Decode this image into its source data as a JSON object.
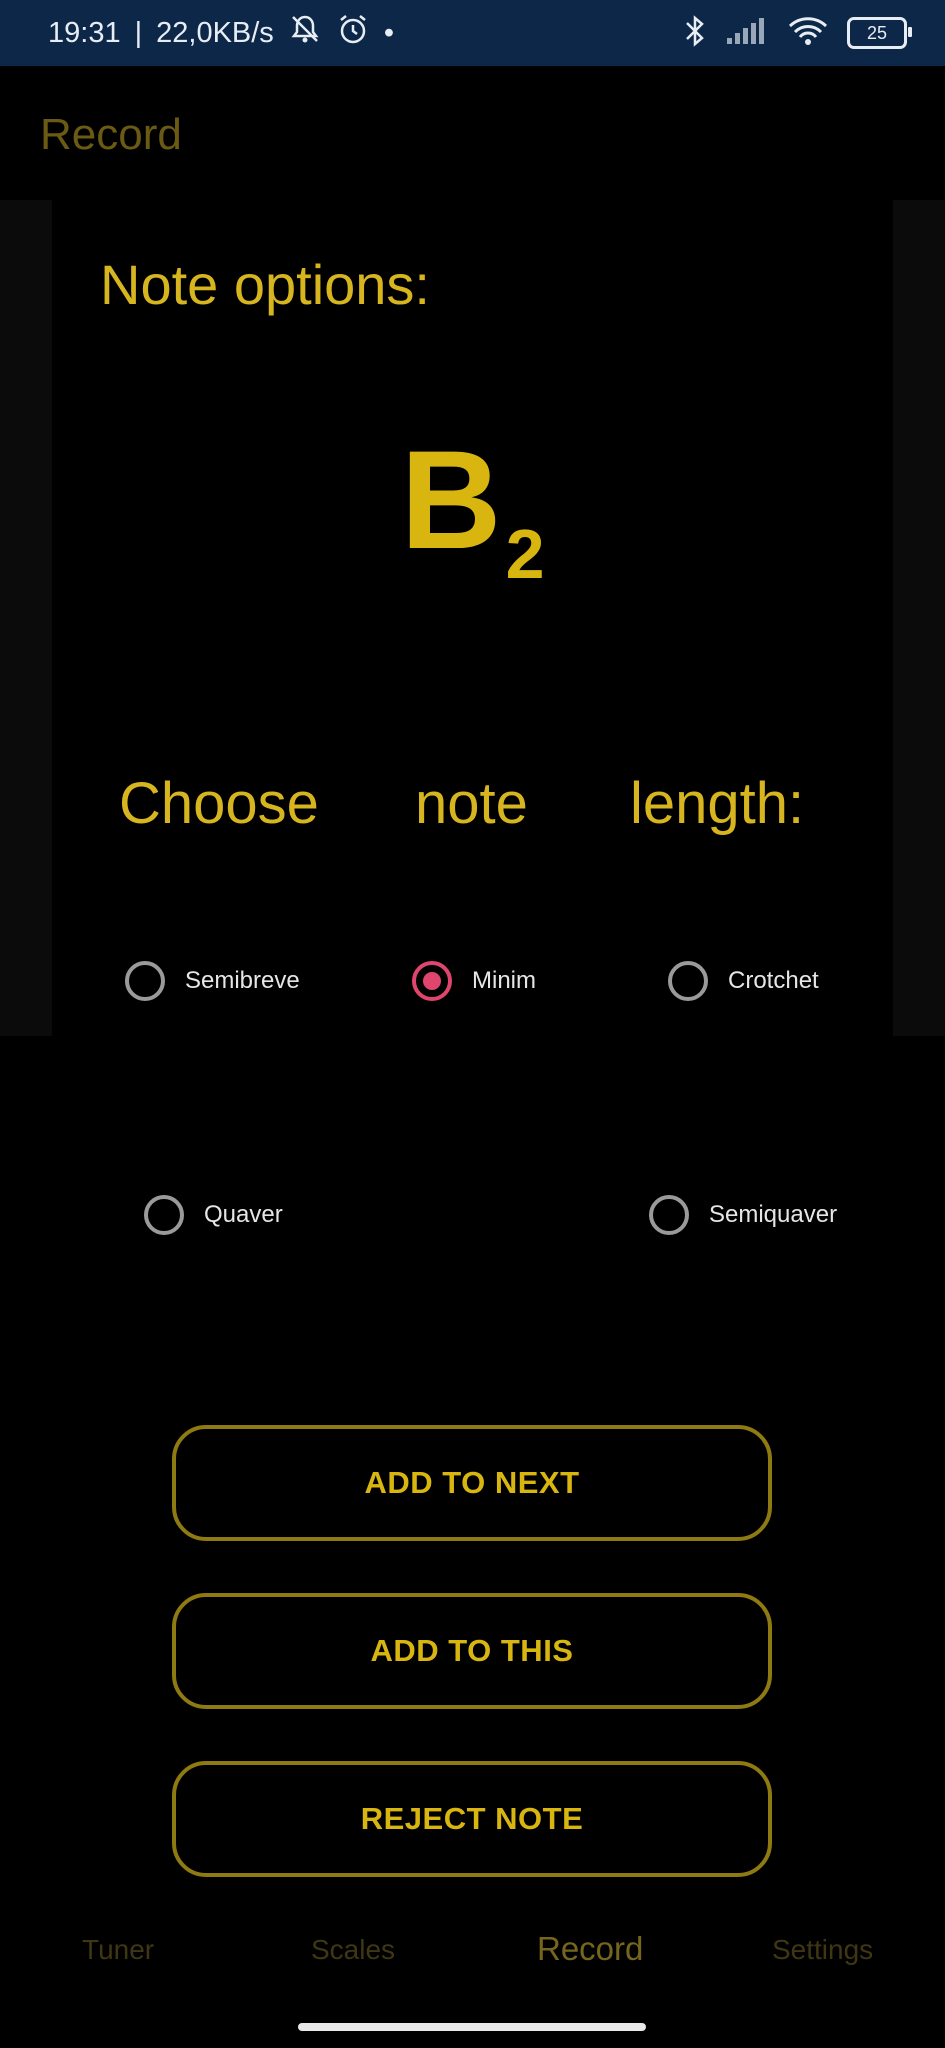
{
  "status_bar": {
    "time": "19:31",
    "separator": "|",
    "speed": "22,0KB/s",
    "dot": "•",
    "battery": "25"
  },
  "app": {
    "title": "Record"
  },
  "dialog": {
    "title": "Note options:",
    "note": {
      "letter": "B",
      "octave": "2"
    },
    "choose_words": [
      "Choose",
      "note",
      "length:"
    ],
    "options": [
      {
        "label": "Semibreve",
        "selected": false
      },
      {
        "label": "Minim",
        "selected": true
      },
      {
        "label": "Crotchet",
        "selected": false
      },
      {
        "label": "Quaver",
        "selected": false
      },
      {
        "label": "Semiquaver",
        "selected": false
      }
    ],
    "buttons": {
      "add_next": "ADD TO NEXT",
      "add_this": "ADD TO THIS",
      "reject": "REJECT NOTE"
    }
  },
  "bottom_nav": {
    "tuner": "Tuner",
    "scales": "Scales",
    "record": "Record",
    "settings": "Settings",
    "active": "Record"
  },
  "colors": {
    "status_bar": "#0c2747",
    "accent_gold": "#d6b51f",
    "radio_selected": "#e0456e",
    "button_border": "#8f7a12"
  }
}
